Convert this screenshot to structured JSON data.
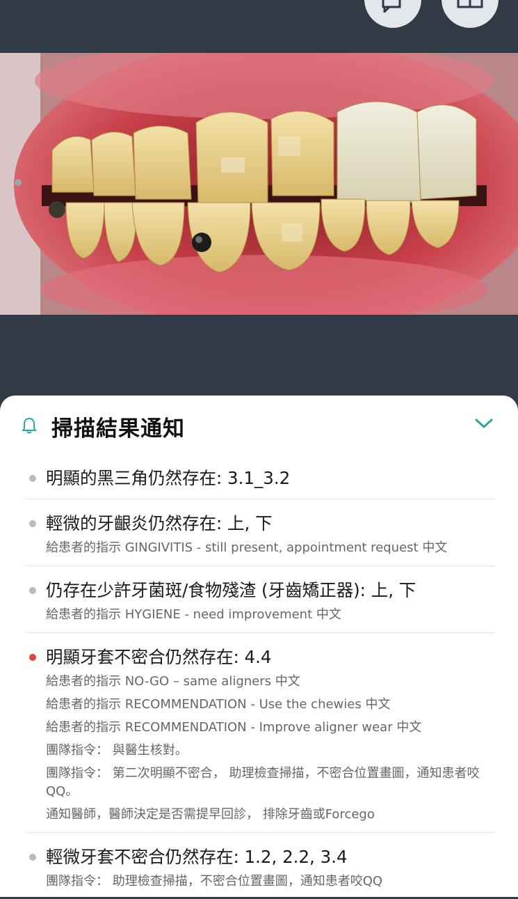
{
  "panel": {
    "title": "掃描結果通知",
    "items": [
      {
        "title": "明顯的黑三角仍然存在: 3.1_3.2",
        "severity": "normal",
        "notes": []
      },
      {
        "title": "輕微的牙齦炎仍然存在: 上, 下",
        "severity": "normal",
        "notes": [
          "給患者的指示 GINGIVITIS - still present, appointment request 中文"
        ]
      },
      {
        "title": "仍存在少許牙菌斑/食物殘渣 (牙齒矯正器): 上, 下",
        "severity": "normal",
        "notes": [
          "給患者的指示 HYGIENE - need improvement 中文"
        ]
      },
      {
        "title": "明顯牙套不密合仍然存在: 4.4",
        "severity": "alert",
        "notes": [
          "給患者的指示 NO-GO – same aligners 中文",
          "給患者的指示 RECOMMENDATION - Use the chewies 中文",
          "給患者的指示 RECOMMENDATION - Improve aligner wear 中文",
          "團隊指令： 與醫生核對。",
          "團隊指令： 第二次明顯不密合， 助理檢查掃描，不密合位置畫圖，通知患者咬QQ。",
          "通知醫師，醫師決定是否需提早回診， 排除牙齒或Forcego"
        ]
      },
      {
        "title": "輕微牙套不密合仍然存在: 1.2, 2.2, 3.4",
        "severity": "normal",
        "notes": [
          "團隊指令： 助理檢查掃描，不密合位置畫圖，通知患者咬QQ"
        ]
      }
    ]
  },
  "icons": {
    "top_left": "chat-icon",
    "top_right": "gallery-icon",
    "header": "bell-icon",
    "collapse": "chevron-down-icon"
  },
  "colors": {
    "accent": "#2aa6a1",
    "alert_dot": "#e34040",
    "normal_dot": "#b6bcc3",
    "background": "#313b46"
  }
}
